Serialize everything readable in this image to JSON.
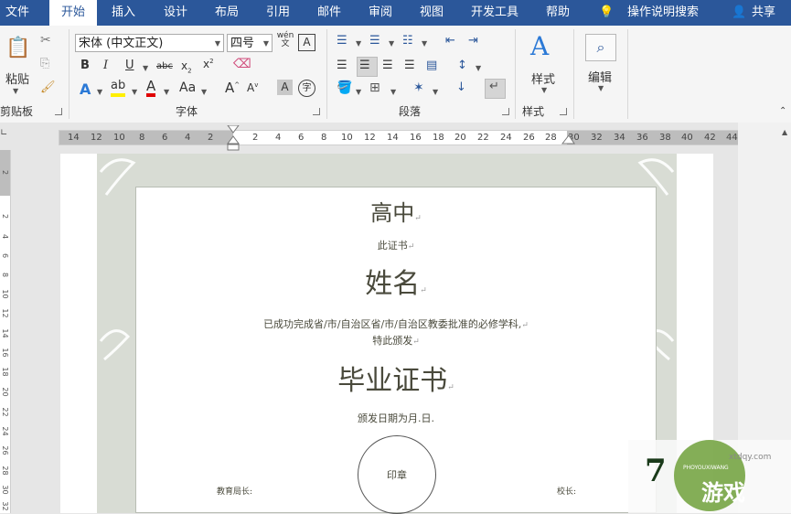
{
  "tabs": [
    {
      "label": "文件"
    },
    {
      "label": "开始"
    },
    {
      "label": "插入"
    },
    {
      "label": "设计"
    },
    {
      "label": "布局"
    },
    {
      "label": "引用"
    },
    {
      "label": "邮件"
    },
    {
      "label": "审阅"
    },
    {
      "label": "视图"
    },
    {
      "label": "开发工具"
    },
    {
      "label": "帮助"
    }
  ],
  "tell_me": "操作说明搜索",
  "share": "共享",
  "clipboard": {
    "paste": "粘贴",
    "group": "剪贴板"
  },
  "font": {
    "name": "宋体 (中文正文)",
    "size": "四号",
    "group": "字体",
    "phonetic": "wén"
  },
  "paragraph": {
    "group": "段落"
  },
  "styles": {
    "label": "样式",
    "group": "样式"
  },
  "editing": {
    "label": "编辑"
  },
  "ruler": [
    "14",
    "12",
    "10",
    "8",
    "6",
    "4",
    "2",
    "2",
    "4",
    "6",
    "8",
    "10",
    "12",
    "14",
    "16",
    "18",
    "20",
    "22",
    "24",
    "26",
    "28",
    "30",
    "32",
    "34",
    "36",
    "38",
    "40",
    "42",
    "44"
  ],
  "vruler": [
    "2",
    "2",
    "4",
    "6",
    "8",
    "10",
    "12",
    "14",
    "16",
    "18",
    "20",
    "22",
    "24",
    "26",
    "28",
    "30",
    "32"
  ],
  "document": {
    "school": "高中",
    "cert_label": "此证书",
    "name": "姓名",
    "body_line1": "已成功完成省/市/自治区省/市/自治区教委批准的必修学科,",
    "body_line2": "特此颁发",
    "title": "毕业证书",
    "date_line": "颁发日期为月.日.",
    "seal": "印章",
    "left_sign": "教育局长:",
    "right_sign": "校长:"
  },
  "watermark": {
    "text": "游戏",
    "sub": "PHOYOUXIWANG",
    "url": "xtdqy.com"
  },
  "colors": {
    "accent": "#2b579a",
    "doc_text": "#4a4a3c"
  }
}
